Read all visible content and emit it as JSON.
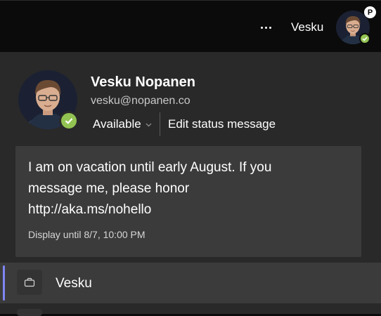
{
  "header": {
    "more_label": "…",
    "user_short_name": "Vesku",
    "badge_letter": "P"
  },
  "profile": {
    "display_name": "Vesku Nopanen",
    "email": "vesku@nopanen.co",
    "status": "Available",
    "edit_status_label": "Edit status message"
  },
  "status_message": {
    "text_lines": [
      "I am on vacation until early August. If you",
      "message me, please honor",
      "http://aka.ms/nohello"
    ],
    "display_until": "Display until 8/7, 10:00 PM"
  },
  "account": {
    "name": "Vesku"
  },
  "colors": {
    "available_green": "#92c353",
    "accent_purple": "#7f85f5",
    "panel_bg": "#292929",
    "card_bg": "#3b3b3b"
  },
  "icons": {
    "more": "more-horizontal-icon",
    "status_check": "check-icon",
    "account_org": "briefcase-icon",
    "dropdown": "chevron-down-icon"
  }
}
